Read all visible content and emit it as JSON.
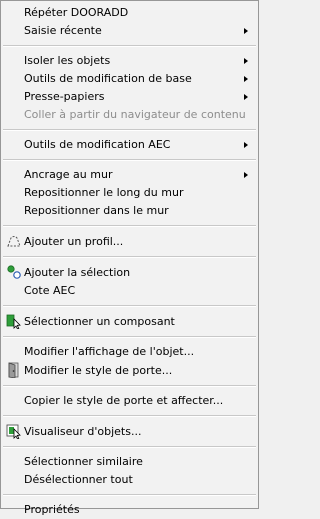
{
  "menu": {
    "items": [
      {
        "label": "Répéter DOORADD"
      },
      {
        "label": "Saisie récente"
      },
      {
        "label": "Isoler les objets"
      },
      {
        "label": "Outils de modification de base"
      },
      {
        "label": "Presse-papiers"
      },
      {
        "label": "Coller à partir du navigateur de contenu"
      },
      {
        "label": "Outils de modification AEC"
      },
      {
        "label": "Ancrage au mur"
      },
      {
        "label": "Repositionner le long du mur"
      },
      {
        "label": "Repositionner dans le mur"
      },
      {
        "label": "Ajouter un profil..."
      },
      {
        "label": "Ajouter la sélection"
      },
      {
        "label": "Cote AEC"
      },
      {
        "label": "Sélectionner un composant"
      },
      {
        "label": "Modifier l'affichage de l'objet..."
      },
      {
        "label": "Modifier le style de porte..."
      },
      {
        "label": "Copier le style de porte et affecter..."
      },
      {
        "label": "Visualiseur d'objets..."
      },
      {
        "label": "Sélectionner similaire"
      },
      {
        "label": "Désélectionner tout"
      },
      {
        "label": "Propriétés"
      }
    ]
  },
  "colors": {
    "background": "#f2f2f2",
    "disabled_text": "#8d8d8d",
    "separator": "#c8c8c8",
    "icon_green": "#2e9e3a",
    "icon_blue": "#2f5fb3"
  },
  "icons": [
    "profile-dashed-icon",
    "add-selection-icon",
    "select-component-icon",
    "door-style-icon",
    "object-viewer-icon"
  ]
}
